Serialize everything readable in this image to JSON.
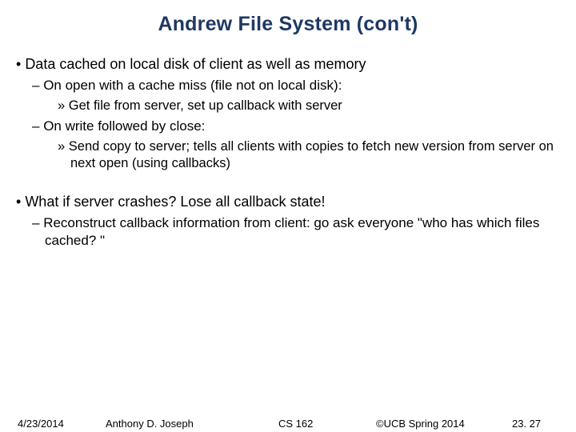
{
  "title": "Andrew File System (con't)",
  "bullets": {
    "b1a": "Data cached on local disk of client as well as memory",
    "b2a": "On open with a cache miss (file not on local disk):",
    "b3a": "Get file from server, set up callback with server",
    "b2b": "On write followed by close:",
    "b3b": "Send copy to server; tells all clients with copies to fetch new version from server on next open (using callbacks)",
    "b1b": "What if server crashes? Lose all callback state!",
    "b2c": "Reconstruct callback information from client: go ask everyone \"who has which files cached? \""
  },
  "footer": {
    "date": "4/23/2014",
    "author": "Anthony D. Joseph",
    "course": "CS 162",
    "copyright": "©UCB Spring 2014",
    "page": "23. 27"
  }
}
